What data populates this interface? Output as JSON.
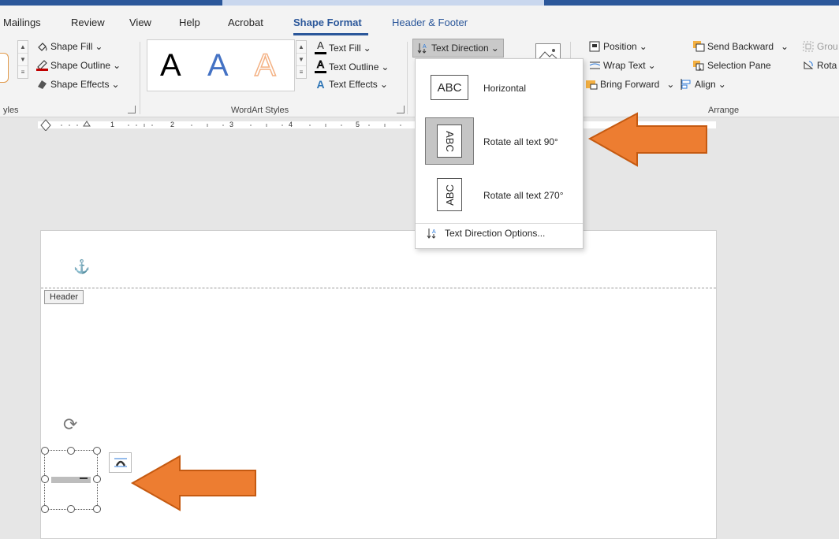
{
  "tabs": [
    {
      "label": "Mailings"
    },
    {
      "label": "Review"
    },
    {
      "label": "View"
    },
    {
      "label": "Help"
    },
    {
      "label": "Acrobat"
    },
    {
      "label": "Shape Format",
      "active": true
    },
    {
      "label": "Header & Footer"
    }
  ],
  "ribbon": {
    "shape_styles": {
      "label_partial": "yles",
      "fill": "Shape Fill",
      "outline": "Shape Outline",
      "effects": "Shape Effects"
    },
    "wordart": {
      "label": "WordArt Styles",
      "sample_letter": "A",
      "text_fill": "Text Fill",
      "text_outline": "Text Outline",
      "text_effects": "Text Effects"
    },
    "text": {
      "direction": "Text Direction"
    },
    "arrange": {
      "label": "Arrange",
      "position": "Position",
      "wrap_text": "Wrap Text",
      "bring_forward": "Bring Forward",
      "send_backward": "Send Backward",
      "selection_pane": "Selection Pane",
      "align": "Align",
      "group_partial": "Grou",
      "rotate_partial": "Rota"
    }
  },
  "ruler": {
    "numbers": [
      "1",
      "2",
      "3",
      "4",
      "5"
    ]
  },
  "text_direction_menu": {
    "icon_text": "ABC",
    "items": [
      {
        "label": "Horizontal",
        "selected": false
      },
      {
        "label": "Rotate all text 90°",
        "selected": true
      },
      {
        "label": "Rotate all text 270°",
        "selected": false
      }
    ],
    "options": "Text Direction Options..."
  },
  "document": {
    "header_tag": "Header"
  },
  "colors": {
    "accent": "#2b579a",
    "callout_arrow": "#ed7d31",
    "anchor": "#2b79d9"
  }
}
